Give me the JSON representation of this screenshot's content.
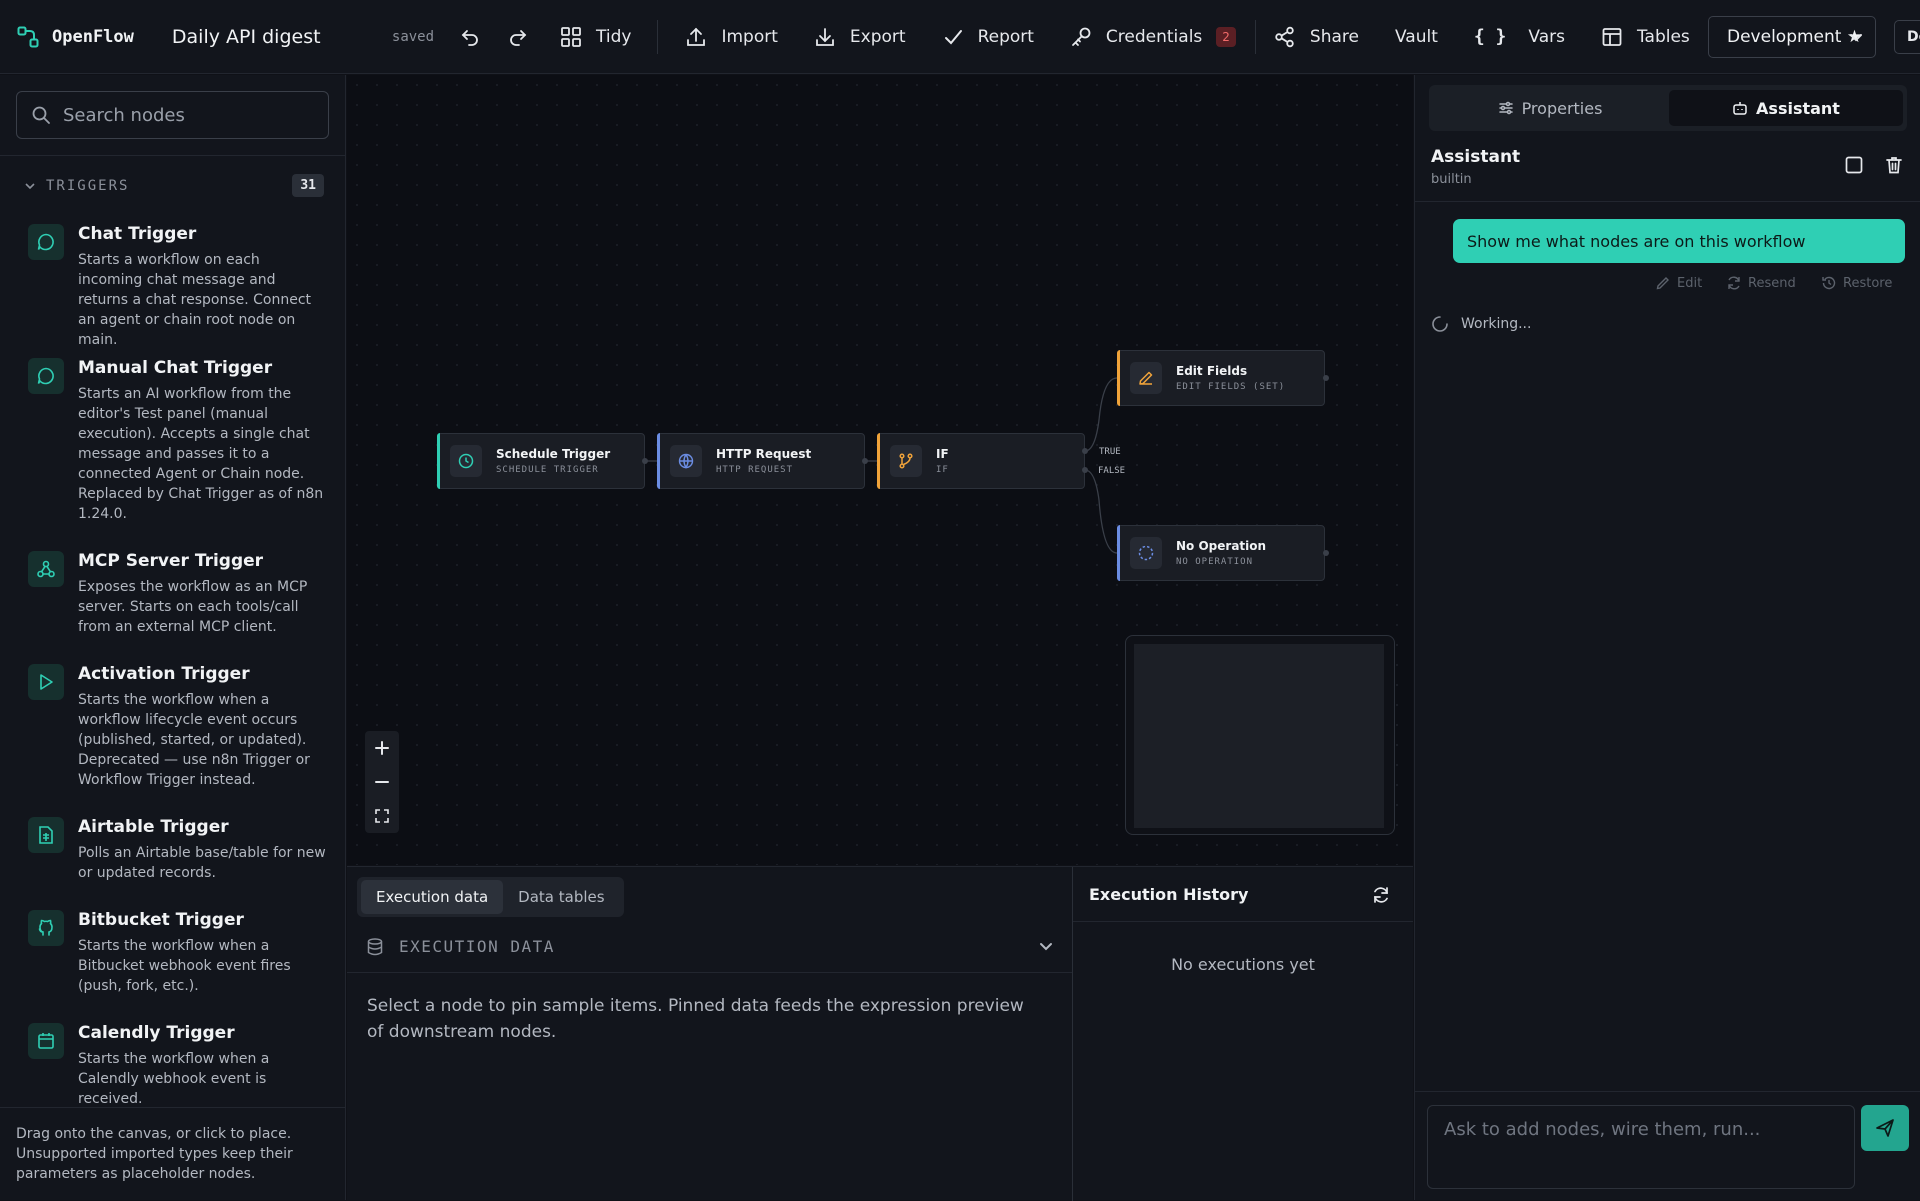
{
  "app": {
    "name": "OpenFlow",
    "workflow_title": "Daily API digest",
    "save_state": "saved"
  },
  "toolbar": {
    "tidy": "Tidy",
    "import": "Import",
    "export": "Export",
    "report": "Report",
    "credentials": "Credentials",
    "credentials_count": "2",
    "share": "Share",
    "vault": "Vault",
    "vars": "Vars",
    "tables": "Tables",
    "environment": "Development ★",
    "environment_2": "De"
  },
  "sidebar": {
    "search_placeholder": "Search nodes",
    "category": "TRIGGERS",
    "category_count": "31",
    "items": [
      {
        "title": "Chat Trigger",
        "desc": "Starts a workflow on each incoming chat message and returns a chat response. Connect an agent or chain root node on main.",
        "icon": "chat-bubble-icon"
      },
      {
        "title": "Manual Chat Trigger",
        "desc": "Starts an AI workflow from the editor's Test panel (manual execution). Accepts a single chat message and passes it to a connected Agent or Chain node. Replaced by Chat Trigger as of n8n 1.24.0.",
        "icon": "chat-bubble-icon"
      },
      {
        "title": "MCP Server Trigger",
        "desc": "Exposes the workflow as an MCP server. Starts on each tools/call from an external MCP client.",
        "icon": "webhook-icon"
      },
      {
        "title": "Activation Trigger",
        "desc": "Starts the workflow when a workflow lifecycle event occurs (published, started, or updated). Deprecated — use n8n Trigger or Workflow Trigger instead.",
        "icon": "play-icon"
      },
      {
        "title": "Airtable Trigger",
        "desc": "Polls an Airtable base/table for new or updated records.",
        "icon": "sheet-icon"
      },
      {
        "title": "Bitbucket Trigger",
        "desc": "Starts the workflow when a Bitbucket webhook event fires (push, fork, etc.).",
        "icon": "git-icon"
      },
      {
        "title": "Calendly Trigger",
        "desc": "Starts the workflow when a Calendly webhook event is received.",
        "icon": "calendar-icon"
      }
    ],
    "footer": "Drag onto the canvas, or click to place. Unsupported imported types keep their parameters as placeholder nodes."
  },
  "canvas": {
    "nodes": [
      {
        "title": "Schedule Trigger",
        "subtitle": "SCHEDULE TRIGGER",
        "icon": "clock-icon",
        "accent": "#2fcfb4"
      },
      {
        "title": "HTTP Request",
        "subtitle": "HTTP REQUEST",
        "icon": "globe-icon",
        "accent": "#6b8de3"
      },
      {
        "title": "IF",
        "subtitle": "IF",
        "icon": "branch-icon",
        "accent": "#f0a33a"
      },
      {
        "title": "Edit Fields",
        "subtitle": "EDIT FIELDS (SET)",
        "icon": "pencil-icon",
        "accent": "#f0a33a"
      },
      {
        "title": "No Operation",
        "subtitle": "NO OPERATION",
        "icon": "dashed-circle-icon",
        "accent": "#6b8de3"
      }
    ],
    "branch_true": "TRUE",
    "branch_false": "FALSE"
  },
  "bottom": {
    "tabs": [
      "Execution data",
      "Data tables"
    ],
    "section": "EXECUTION DATA",
    "message": "Select a node to pin sample items. Pinned data feeds the expression preview of downstream nodes.",
    "history_title": "Execution History",
    "history_empty": "No executions yet"
  },
  "assistant": {
    "tabs": [
      "Properties",
      "Assistant"
    ],
    "title": "Assistant",
    "subtitle": "builtin",
    "user_message": "Show me what nodes are on this workflow",
    "actions": [
      "Edit",
      "Resend",
      "Restore"
    ],
    "status": "Working...",
    "input_placeholder": "Ask to add nodes, wire them, run..."
  },
  "colors": {
    "accent": "#2fcfb4",
    "bg": "#0f1117",
    "panel": "#12151c",
    "danger": "#f06a6a"
  }
}
